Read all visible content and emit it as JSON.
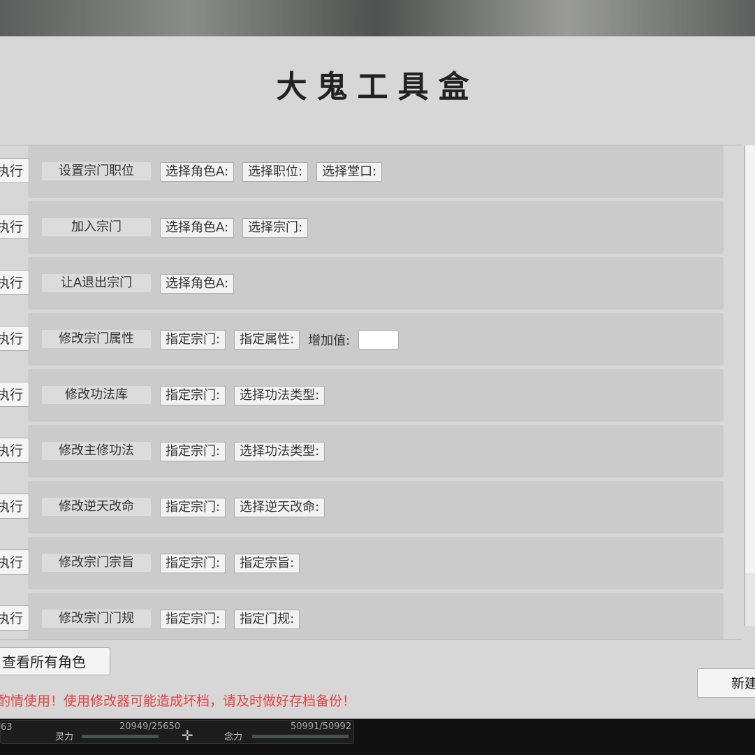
{
  "title": "大鬼工具盒",
  "execute_label": "执行",
  "rows": [
    {
      "label": "设置宗门职位",
      "options": [
        "选择角色A:",
        "选择职位:",
        "选择堂口:"
      ]
    },
    {
      "label": "加入宗门",
      "options": [
        "选择角色A:",
        "选择宗门:"
      ]
    },
    {
      "label": "让A退出宗门",
      "options": [
        "选择角色A:"
      ]
    },
    {
      "label": "修改宗门属性",
      "options": [
        "指定宗门:",
        "指定属性:"
      ],
      "extra_label": "增加值:"
    },
    {
      "label": "修改功法库",
      "options": [
        "指定宗门:",
        "选择功法类型:"
      ]
    },
    {
      "label": "修改主修功法",
      "options": [
        "指定宗门:",
        "选择功法类型:"
      ]
    },
    {
      "label": "修改逆天改命",
      "options": [
        "指定宗门:",
        "选择逆天改命:"
      ]
    },
    {
      "label": "修改宗门宗旨",
      "options": [
        "指定宗门:",
        "指定宗旨:"
      ]
    },
    {
      "label": "修改宗门门规",
      "options": [
        "指定宗门:",
        "指定门规:"
      ]
    }
  ],
  "view_all_label": "查看所有角色",
  "new_label": "新建",
  "warning": "酌情使用！使用修改器可能造成坏档，请及时做好存档备份！",
  "hud": {
    "left_value": "63",
    "lingli_label": "灵力",
    "lingli_value": "20949/25650",
    "nianli_label": "念力",
    "nianli_value": "50991/50992"
  }
}
